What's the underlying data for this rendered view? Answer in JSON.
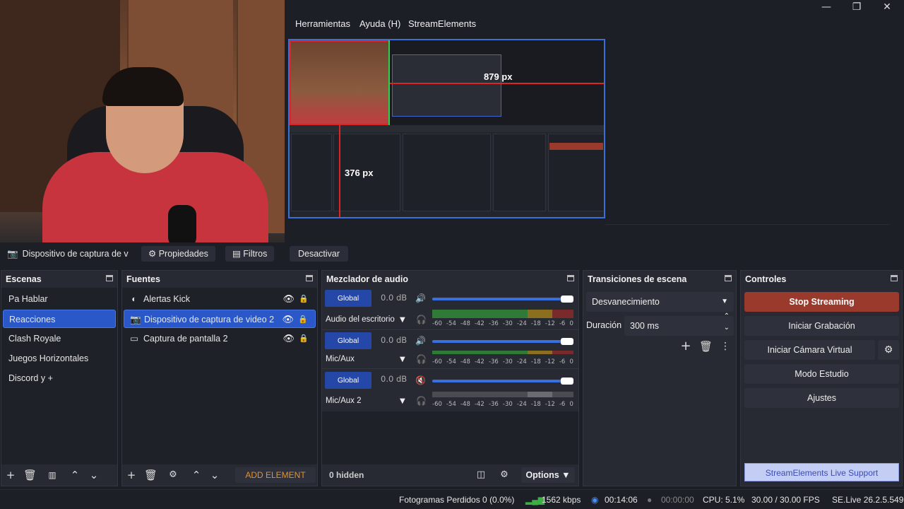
{
  "menubar": {
    "items": [
      "Herramientas",
      "Ayuda (H)",
      "StreamElements"
    ]
  },
  "window_controls": {
    "minimize": "—",
    "maximize": "❐",
    "close": "✕"
  },
  "preview": {
    "label_width": "879 px",
    "label_height": "376 px"
  },
  "sourcebar": {
    "source_name": "Dispositivo de captura de v",
    "properties": "Propiedades",
    "filters": "Filtros",
    "deactivate": "Desactivar"
  },
  "scenes": {
    "title": "Escenas",
    "items": [
      "Pa Hablar",
      "Reacciones",
      "Clash Royale",
      "Juegos Horizontales",
      "Discord y +"
    ],
    "selected": 1
  },
  "sources": {
    "title": "Fuentes",
    "items": [
      {
        "name": "Alertas Kick",
        "icon": "globe-icon"
      },
      {
        "name": "Dispositivo de captura de video 2",
        "icon": "camera-icon"
      },
      {
        "name": "Captura de pantalla 2",
        "icon": "monitor-icon"
      }
    ],
    "selected": 1,
    "add_element": "ADD ELEMENT"
  },
  "mixer": {
    "title": "Mezclador de audio",
    "channels": [
      {
        "global": "Global",
        "db": "0.0 dB",
        "name": "Audio del escritorio",
        "muted": false
      },
      {
        "global": "Global",
        "db": "0.0 dB",
        "name": "Mic/Aux",
        "muted": false
      },
      {
        "global": "Global",
        "db": "0.0 dB",
        "name": "Mic/Aux 2",
        "muted": true
      }
    ],
    "ticks": [
      "-60",
      "-54",
      "-48",
      "-42",
      "-36",
      "-30",
      "-24",
      "-18",
      "-12",
      "-6",
      "0"
    ],
    "hidden": "0 hidden",
    "options": "Options"
  },
  "transitions": {
    "title": "Transiciones de escena",
    "selected": "Desvanecimiento",
    "duration_label": "Duración",
    "duration_value": "300 ms"
  },
  "controls": {
    "title": "Controles",
    "stop_streaming": "Stop Streaming",
    "start_recording": "Iniciar Grabación",
    "start_virtual_cam": "Iniciar Cámara Virtual",
    "studio_mode": "Modo Estudio",
    "settings": "Ajustes",
    "se_support": "StreamElements Live Support"
  },
  "status": {
    "dropped_frames": "Fotogramas Perdidos 0 (0.0%)",
    "bitrate": "1562 kbps",
    "stream_time": "00:14:06",
    "rec_time": "00:00:00",
    "cpu": "CPU: 5.1%",
    "fps": "30.00 / 30.00 FPS",
    "version": "SE.Live 26.2.5.549"
  },
  "colors": {
    "accent": "#2b58c9",
    "stop": "#9a3a2c",
    "preview_border": "#3a6fd8"
  }
}
